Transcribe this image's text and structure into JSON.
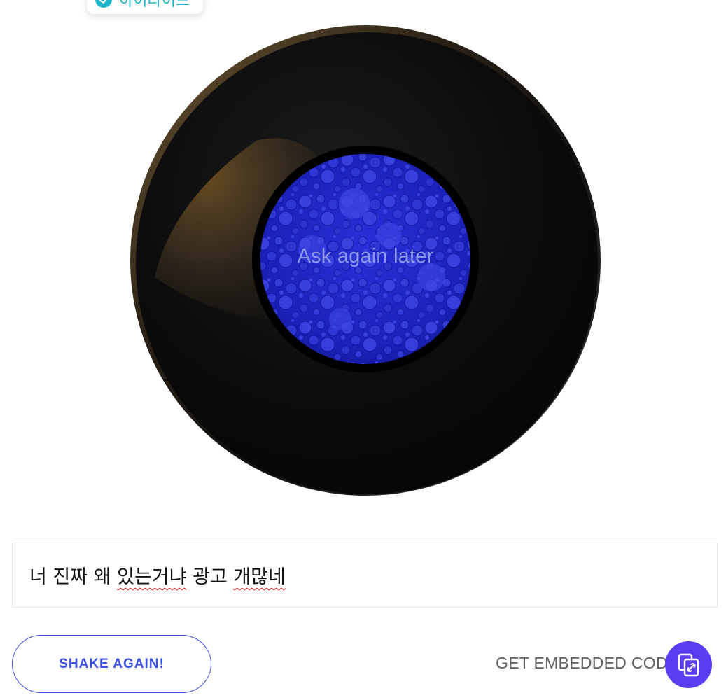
{
  "top_chip": {
    "label": "하이라이트",
    "icon": "check-circle-icon",
    "color": "#1cb5c7"
  },
  "ball": {
    "answer": "Ask again later",
    "window_color": "#1d22c8",
    "answer_color": "#8d97e8"
  },
  "question": {
    "parts": [
      "너 진짜 왜 ",
      "있는거냐",
      " 광고 ",
      "개많네"
    ]
  },
  "actions": {
    "shake_label": "SHAKE AGAIN!",
    "embed_label": "GET EMBEDDED CODE",
    "embed_icon": "copy-link-icon",
    "accent": "#5b3ef4",
    "button_border": "#3c52e6"
  }
}
